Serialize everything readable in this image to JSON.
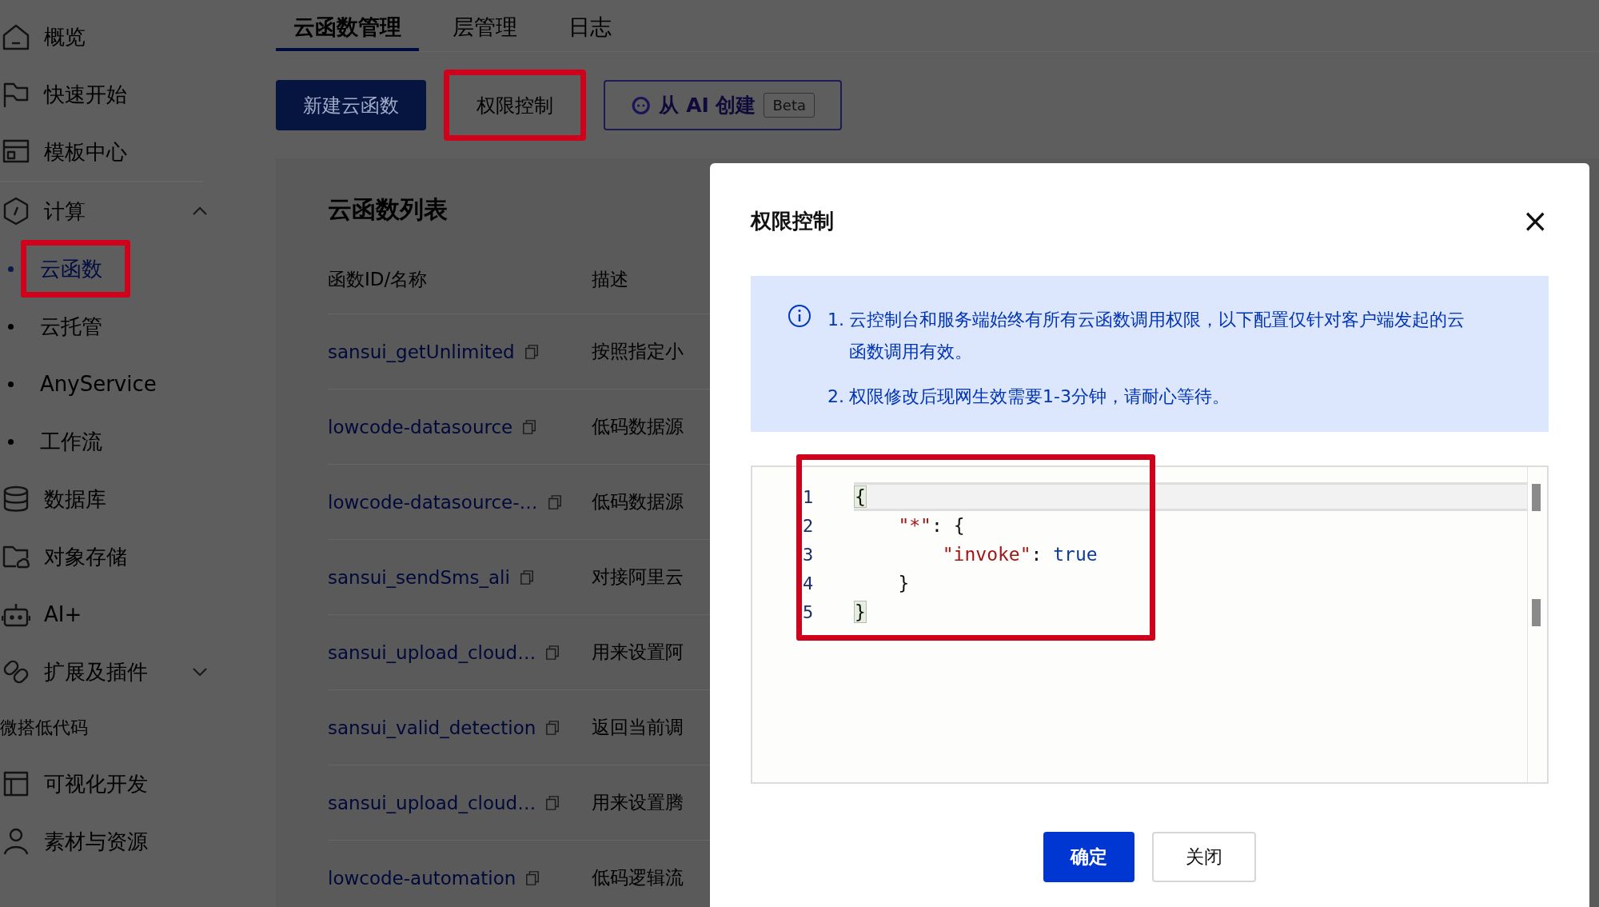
{
  "sidebar": {
    "items": [
      {
        "kind": "link",
        "label": "概览",
        "selected": false
      },
      {
        "kind": "link",
        "label": "快速开始",
        "selected": false
      },
      {
        "kind": "link",
        "label": "模板中心",
        "selected": false
      },
      {
        "kind": "divider"
      },
      {
        "kind": "group",
        "label": "计算",
        "selected": false,
        "expanded": true,
        "children": [
          {
            "label": "云函数",
            "selected": true,
            "highlighted": true
          },
          {
            "label": "云托管",
            "selected": false,
            "highlighted": false
          },
          {
            "label": "AnyService",
            "selected": false,
            "highlighted": false
          },
          {
            "label": "工作流",
            "selected": false,
            "highlighted": false
          }
        ]
      },
      {
        "kind": "link",
        "label": "数据库",
        "selected": false
      },
      {
        "kind": "link",
        "label": "对象存储",
        "selected": false
      },
      {
        "kind": "link",
        "label": "AI+",
        "selected": false
      },
      {
        "kind": "group",
        "label": "扩展及插件",
        "selected": false,
        "expanded": false
      },
      {
        "kind": "section",
        "label": "微搭低代码"
      },
      {
        "kind": "link",
        "label": "可视化开发",
        "selected": false
      },
      {
        "kind": "link",
        "label": "素材与资源",
        "selected": false
      }
    ]
  },
  "tabs": [
    {
      "label": "云函数管理",
      "selected": true
    },
    {
      "label": "层管理",
      "selected": false
    },
    {
      "label": "日志",
      "selected": false
    }
  ],
  "toolbar": [
    {
      "kind": "primary",
      "label": "新建云函数",
      "highlighted": false
    },
    {
      "kind": "default",
      "label": "权限控制",
      "highlighted": true
    },
    {
      "kind": "ai",
      "label": "从 AI 创建",
      "badge": "Beta",
      "highlighted": false
    }
  ],
  "table": {
    "title": "云函数列表",
    "columns": [
      "函数ID/名称",
      "描述"
    ],
    "rows": [
      [
        "sansui_getUnlimited",
        "按照指定小"
      ],
      [
        "lowcode-datasource",
        "低码数据源"
      ],
      [
        "lowcode-datasource-…",
        "低码数据源"
      ],
      [
        "sansui_sendSms_ali",
        "对接阿里云"
      ],
      [
        "sansui_upload_cloud…",
        "用来设置阿"
      ],
      [
        "sansui_valid_detection",
        "返回当前调"
      ],
      [
        "sansui_upload_cloud…",
        "用来设置腾"
      ],
      [
        "lowcode-automation",
        "低码逻辑流"
      ]
    ]
  },
  "dialog": {
    "title": "权限控制",
    "close": "×",
    "notice": [
      {
        "number": "1.",
        "text": "云控制台和服务端始终有所有云函数调用权限，以下配置仅针对客户端发起的云函数调用有效。"
      },
      {
        "number": "2.",
        "text": "权限修改后现网生效需要1-3分钟，请耐心等待。"
      }
    ],
    "editor": {
      "highlighted": true,
      "lines": [
        {
          "number": "1",
          "current": true,
          "tokens": [
            {
              "text": "{",
              "kind": "bracket"
            }
          ]
        },
        {
          "number": "2",
          "current": false,
          "tokens": [
            {
              "text": "    \"*\"",
              "kind": "string"
            },
            {
              "text": ": {",
              "kind": "punct"
            }
          ]
        },
        {
          "number": "3",
          "current": false,
          "tokens": [
            {
              "text": "        \"invoke\"",
              "kind": "string"
            },
            {
              "text": ": ",
              "kind": "punct"
            },
            {
              "text": "true",
              "kind": "keyword"
            }
          ]
        },
        {
          "number": "4",
          "current": false,
          "tokens": [
            {
              "text": "    }",
              "kind": "punct"
            }
          ]
        },
        {
          "number": "5",
          "current": false,
          "tokens": [
            {
              "text": "}",
              "kind": "bracket"
            }
          ]
        }
      ]
    },
    "buttons": [
      {
        "kind": "primary",
        "label": "确定"
      },
      {
        "kind": "default",
        "label": "关闭"
      }
    ]
  }
}
